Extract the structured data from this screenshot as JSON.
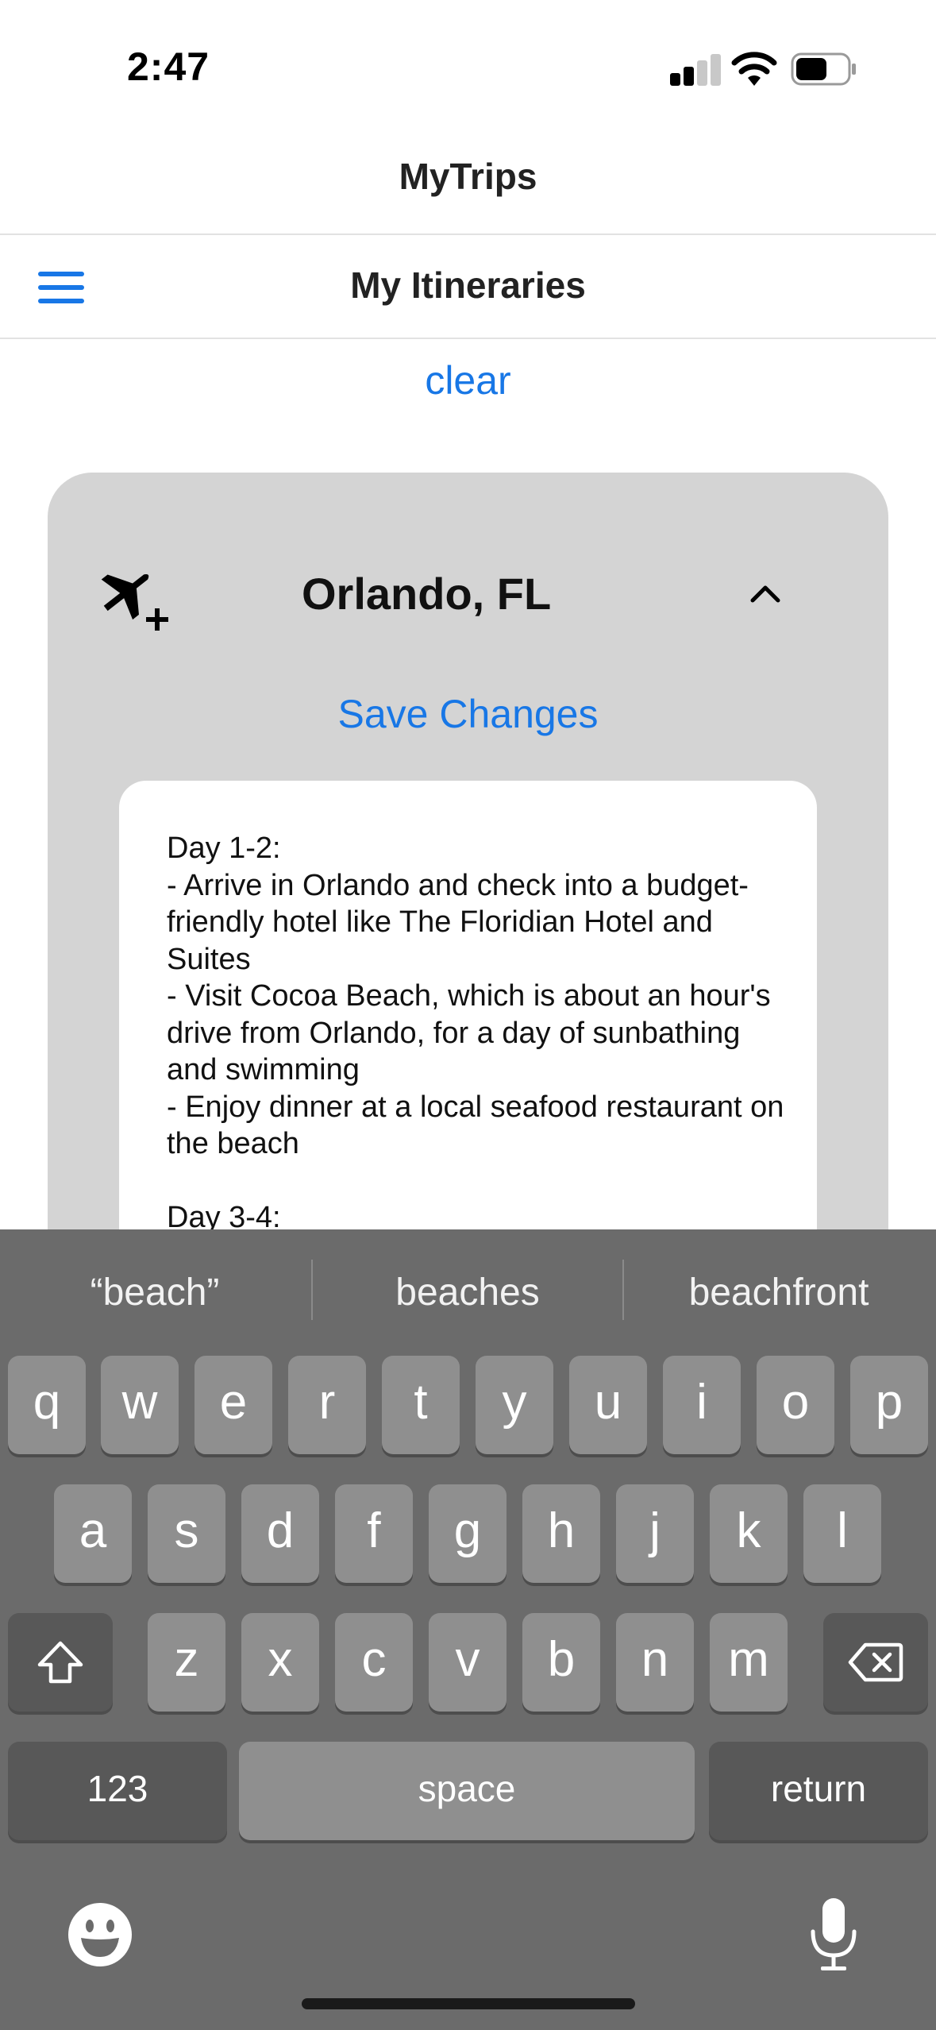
{
  "status": {
    "time": "2:47"
  },
  "app": {
    "title": "MyTrips"
  },
  "nav": {
    "title": "My Itineraries"
  },
  "actions": {
    "clear_label": "clear",
    "save_label": "Save Changes"
  },
  "trip": {
    "destination": "Orlando, FL",
    "itinerary": "Day 1-2:\n- Arrive in Orlando and check into a budget-friendly hotel like The Floridian Hotel and Suites\n- Visit Cocoa Beach, which is about an hour's drive from Orlando, for a day of sunbathing and swimming\n- Enjoy dinner at a local seafood restaurant on the beach\n\nDay 3-4:"
  },
  "keyboard": {
    "suggestions": [
      "“beach”",
      "beaches",
      "beachfront"
    ],
    "row1": [
      "q",
      "w",
      "e",
      "r",
      "t",
      "y",
      "u",
      "i",
      "o",
      "p"
    ],
    "row2": [
      "a",
      "s",
      "d",
      "f",
      "g",
      "h",
      "j",
      "k",
      "l"
    ],
    "row3": [
      "z",
      "x",
      "c",
      "v",
      "b",
      "n",
      "m"
    ],
    "numbers_label": "123",
    "space_label": "space",
    "return_label": "return"
  },
  "icons": {
    "menu": "hamburger-menu-icon",
    "plane": "airplane-add-icon",
    "chevron": "chevron-up-icon",
    "shift": "shift-icon",
    "delete": "backspace-icon",
    "emoji": "emoji-icon",
    "mic": "microphone-icon"
  },
  "colors": {
    "accent": "#1877e6",
    "card": "#d4d4d4",
    "keyboard": "#6b6b6b"
  }
}
